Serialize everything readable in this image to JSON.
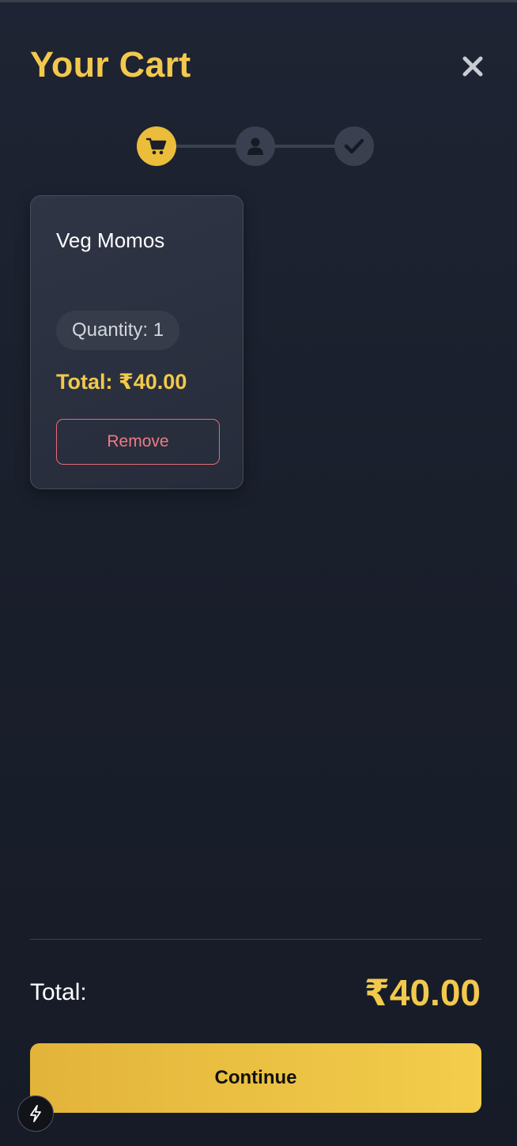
{
  "header": {
    "title": "Your Cart",
    "close_icon": "close-icon"
  },
  "stepper": {
    "steps": [
      {
        "icon": "cart-icon",
        "state": "active"
      },
      {
        "icon": "user-icon",
        "state": "pending"
      },
      {
        "icon": "check-icon",
        "state": "pending"
      }
    ]
  },
  "cart": {
    "items": [
      {
        "name": "Veg Momos",
        "quantity_label": "Quantity: 1",
        "total_label": "Total: ₹40.00",
        "remove_label": "Remove"
      }
    ]
  },
  "summary": {
    "total_label": "Total:",
    "total_value": "₹40.00"
  },
  "actions": {
    "continue_label": "Continue"
  },
  "floating_button": {
    "icon": "lightning-icon"
  },
  "colors": {
    "accent": "#f2c94c",
    "background": "#1a1f2c",
    "card": "#2b3140",
    "danger": "#e56b79"
  }
}
